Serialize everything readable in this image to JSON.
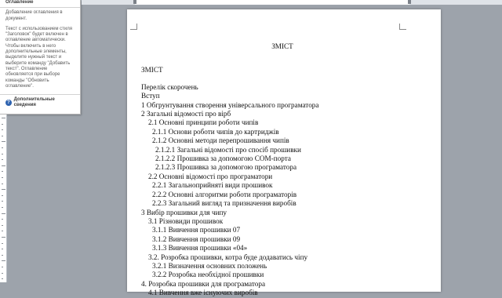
{
  "tooltip": {
    "title": "Оглавление",
    "para1": "Добавление оглавления в документ.",
    "para2": "Текст с использованием стиля \"Заголовок\" будет включен в оглавление автоматически. Чтобы включить в него дополнительные элементы, выделите нужный текст и выберите команду \"Добавить текст\". Оглавление обновляется при выборе команды \"Обновить оглавление\".",
    "more_link": "Дополнительные сведения",
    "help_icon_glyph": "?"
  },
  "document": {
    "heading": "ЗМІСТ",
    "toc_heading": "ЗМІСТ",
    "toc": [
      {
        "text": "Перелік скорочень",
        "level": 0
      },
      {
        "text": "Вступ",
        "level": 0
      },
      {
        "text": "1 Обгрунтування створення універсального програматора",
        "level": 0
      },
      {
        "text": "2 Загальні відомості про вірб",
        "level": 0
      },
      {
        "text": "2.1 Основні принципи роботи чипів",
        "level": 1
      },
      {
        "text": "2.1.1 Основи роботи чипів до картриджів",
        "level": 2
      },
      {
        "text": "2.1.2 Основні методи перепрошивання чипів",
        "level": 2
      },
      {
        "text": "2.1.2.1 Загальні відомості про спосіб прошивки",
        "level": 3
      },
      {
        "text": "2.1.2.2 Прошивка за допомогою COM-порта",
        "level": 3
      },
      {
        "text": "2.1.2.3 Прошивка за допомогою програматора",
        "level": 3
      },
      {
        "text": "2.2 Основні відомості про програматори",
        "level": 1
      },
      {
        "text": "2.2.1 Загальноприйняті види прошивок",
        "level": 2
      },
      {
        "text": "2.2.2 Основні алгоритми роботи програматорів",
        "level": 2
      },
      {
        "text": "2.2.3 Загальний вигляд та призначення виробів",
        "level": 2
      },
      {
        "text": "3 Вибір прошивки для чипу",
        "level": 0
      },
      {
        "text": "3.1 Різновиди прошивок",
        "level": 1
      },
      {
        "text": "3.1.1 Вивчення прошивки 07",
        "level": 2
      },
      {
        "text": "3.1.2 Вивчення прошивки 09",
        "level": 2
      },
      {
        "text": "3.1.3 Вивчення прошивки «04»",
        "level": 2
      },
      {
        "text": "3.2. Розробка прошивки, котра буде додаватись чіпу",
        "level": 1
      },
      {
        "text": "3.2.1 Визначення основних положень",
        "level": 2
      },
      {
        "text": "3.2.2 Розробка необхідної прошивки",
        "level": 2
      },
      {
        "text": "4. Розробка прошивки для програматора",
        "level": 0
      },
      {
        "text": "4.1 Вивчення вже існуючих виробів",
        "level": 1
      }
    ]
  },
  "colors": {
    "workspace": "#9da3ab",
    "help_icon": "#2e63b0"
  }
}
